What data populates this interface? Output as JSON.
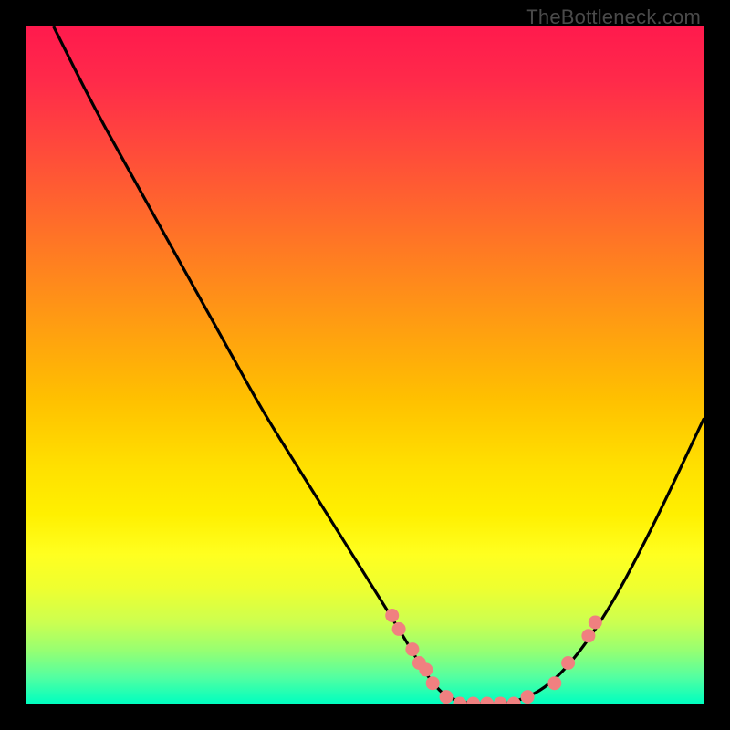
{
  "watermark": "TheBottleneck.com",
  "chart_data": {
    "type": "line",
    "title": "",
    "xlabel": "",
    "ylabel": "",
    "xlim": [
      0,
      100
    ],
    "ylim": [
      0,
      100
    ],
    "grid": false,
    "series": [
      {
        "name": "bottleneck-curve",
        "x": [
          4,
          10,
          15,
          20,
          25,
          30,
          35,
          40,
          45,
          50,
          55,
          58,
          60,
          62,
          65,
          68,
          72,
          78,
          85,
          92,
          100
        ],
        "values": [
          100,
          88,
          79,
          70,
          61,
          52,
          43,
          35,
          27,
          19,
          11,
          6,
          3,
          1,
          0,
          0,
          0,
          3,
          12,
          25,
          42
        ]
      },
      {
        "name": "data-points",
        "type": "scatter",
        "x": [
          54,
          55,
          57,
          58,
          59,
          60,
          62,
          64,
          66,
          68,
          70,
          72,
          74,
          78,
          80,
          83,
          84
        ],
        "values": [
          13,
          11,
          8,
          6,
          5,
          3,
          1,
          0,
          0,
          0,
          0,
          0,
          1,
          3,
          6,
          10,
          12
        ]
      }
    ],
    "colors": {
      "curve": "#000000",
      "points": "#f08080"
    }
  }
}
